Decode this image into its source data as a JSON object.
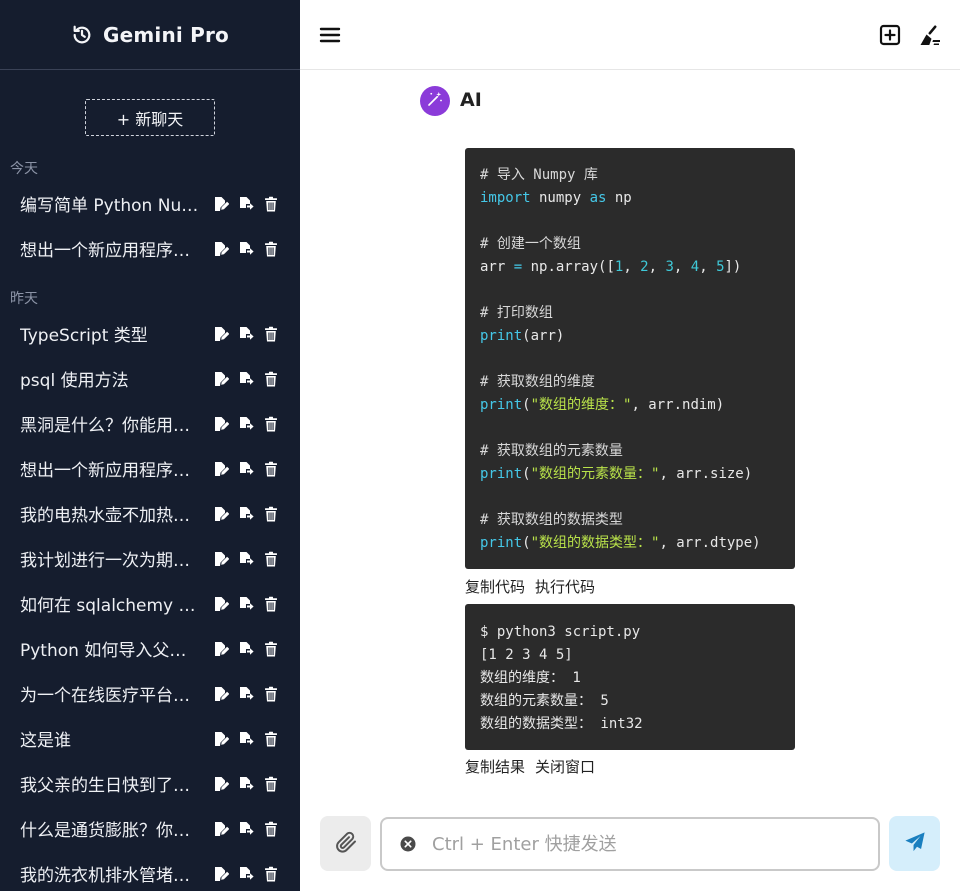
{
  "sidebar": {
    "app_title": "Gemini Pro",
    "new_chat_label": "+ 新聊天",
    "groups": [
      {
        "label": "今天",
        "items": [
          "编写简单 Python Numpy 程序",
          "想出一个新应用程序的名称"
        ]
      },
      {
        "label": "昨天",
        "items": [
          "TypeScript 类型",
          "psql 使用方法",
          "黑洞是什么？你能用简单的语言解释吗",
          "想出一个新应用程序的名称",
          "我的电热水壶不加热了怎么办",
          "我计划进行一次为期一周的旅行",
          "如何在 sqlalchemy 中使用事务",
          "Python 如何导入父级目录模块",
          "为一个在线医疗平台写一段介绍",
          "这是谁",
          "我父亲的生日快到了，送什么礼物好",
          "什么是通货膨胀？你能解释一下吗",
          "我的洗衣机排水管堵了怎么办"
        ]
      }
    ]
  },
  "message": {
    "sender": "AI",
    "code_lines": [
      [
        {
          "t": "# 导入 Numpy 库",
          "c": "comment"
        }
      ],
      [
        {
          "t": "import",
          "c": "kw"
        },
        {
          "t": " numpy ",
          "c": ""
        },
        {
          "t": "as",
          "c": "kw"
        },
        {
          "t": " np",
          "c": ""
        }
      ],
      [],
      [
        {
          "t": "# 创建一个数组",
          "c": "comment"
        }
      ],
      [
        {
          "t": "arr ",
          "c": ""
        },
        {
          "t": "=",
          "c": "kw"
        },
        {
          "t": " np.array([",
          "c": ""
        },
        {
          "t": "1",
          "c": "num"
        },
        {
          "t": ", ",
          "c": ""
        },
        {
          "t": "2",
          "c": "num"
        },
        {
          "t": ", ",
          "c": ""
        },
        {
          "t": "3",
          "c": "num"
        },
        {
          "t": ", ",
          "c": ""
        },
        {
          "t": "4",
          "c": "num"
        },
        {
          "t": ", ",
          "c": ""
        },
        {
          "t": "5",
          "c": "num"
        },
        {
          "t": "])",
          "c": ""
        }
      ],
      [],
      [
        {
          "t": "# 打印数组",
          "c": "comment"
        }
      ],
      [
        {
          "t": "print",
          "c": "fn"
        },
        {
          "t": "(arr)",
          "c": ""
        }
      ],
      [],
      [
        {
          "t": "# 获取数组的维度",
          "c": "comment"
        }
      ],
      [
        {
          "t": "print",
          "c": "fn"
        },
        {
          "t": "(",
          "c": ""
        },
        {
          "t": "\"数组的维度：\"",
          "c": "str"
        },
        {
          "t": ", arr.ndim)",
          "c": ""
        }
      ],
      [],
      [
        {
          "t": "# 获取数组的元素数量",
          "c": "comment"
        }
      ],
      [
        {
          "t": "print",
          "c": "fn"
        },
        {
          "t": "(",
          "c": ""
        },
        {
          "t": "\"数组的元素数量：\"",
          "c": "str"
        },
        {
          "t": ", arr.size)",
          "c": ""
        }
      ],
      [],
      [
        {
          "t": "# 获取数组的数据类型",
          "c": "comment"
        }
      ],
      [
        {
          "t": "print",
          "c": "fn"
        },
        {
          "t": "(",
          "c": ""
        },
        {
          "t": "\"数组的数据类型：\"",
          "c": "str"
        },
        {
          "t": ", arr.dtype)",
          "c": ""
        }
      ]
    ],
    "copy_code_label": "复制代码",
    "run_code_label": "执行代码",
    "result_lines": [
      "$ python3 script.py",
      "[1 2 3 4 5]",
      "数组的维度： 1",
      "数组的元素数量： 5",
      "数组的数据类型： int32"
    ],
    "copy_result_label": "复制结果",
    "close_window_label": "关闭窗口"
  },
  "input": {
    "placeholder": "Ctrl + Enter 快捷发送",
    "value": ""
  },
  "colors": {
    "sidebar_bg": "#151d2e",
    "avatar": "#8b3bd9",
    "send_btn_bg": "#d5eefb",
    "send_icon": "#1a7fbf",
    "code_bg": "#2b2b2b"
  },
  "icons": {
    "logo": "history-icon",
    "menu": "menu-icon",
    "add": "add-square-icon",
    "clean": "broom-icon",
    "attach": "paperclip-icon",
    "send": "paper-plane-icon",
    "clear": "clear-circle-icon"
  }
}
